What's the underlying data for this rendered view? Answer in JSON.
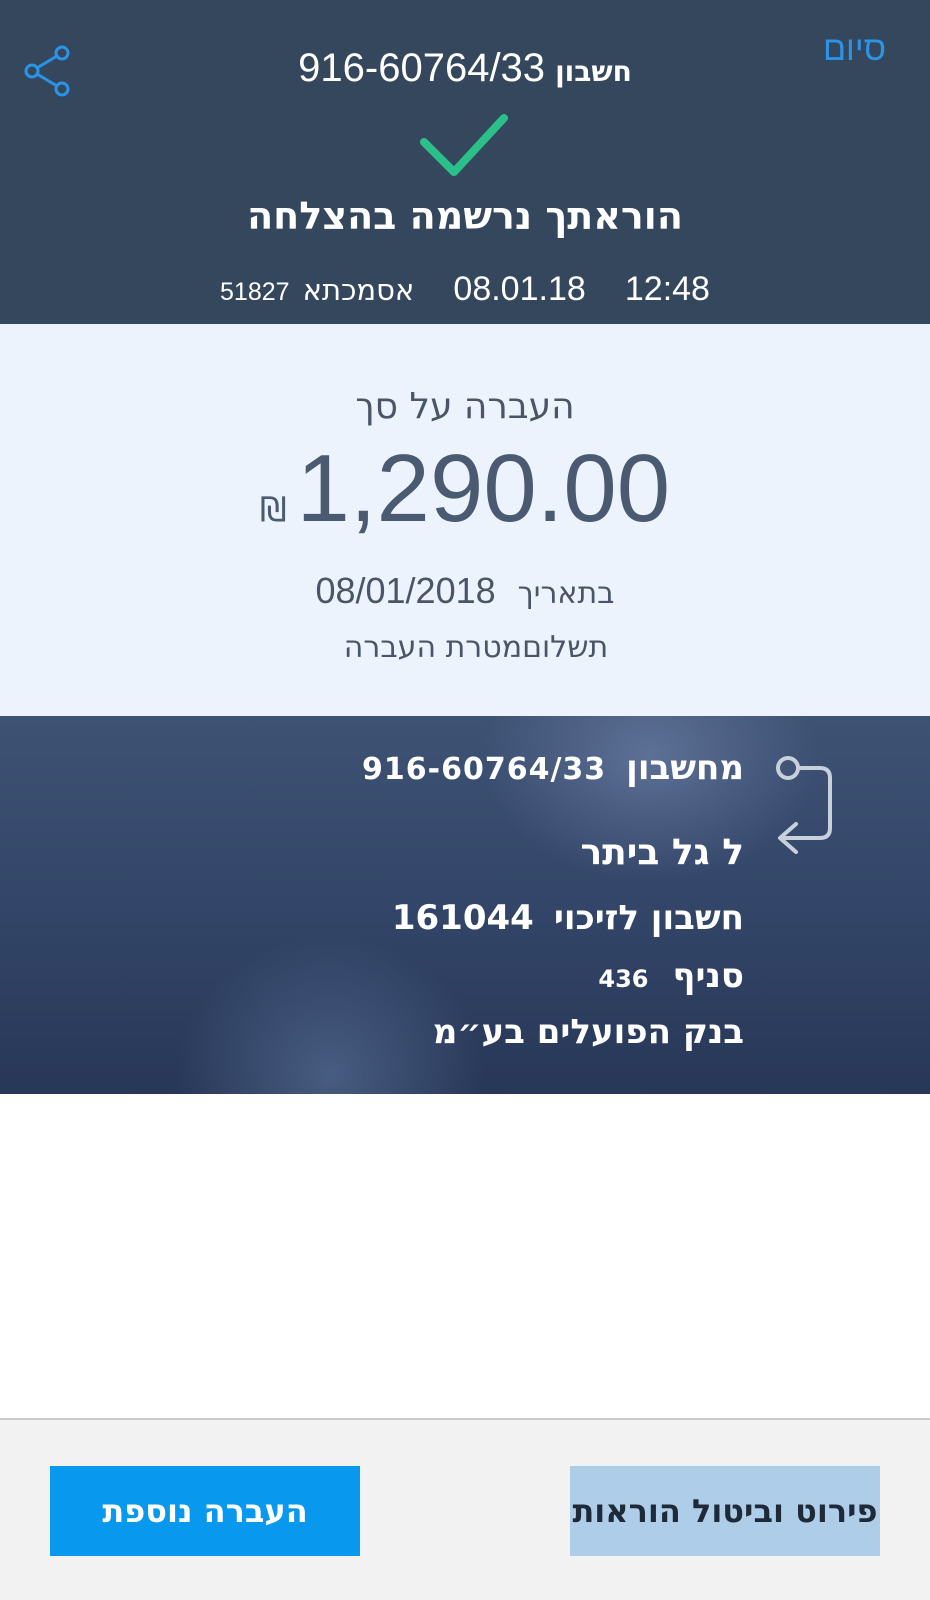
{
  "header": {
    "done_label": "סיום",
    "account_label": "חשבון",
    "account_number": "916-60764/33",
    "success_title": "הוראתך נרשמה בהצלחה",
    "time": "12:48",
    "date": "08.01.18",
    "reference_label": "אסמכתא",
    "reference_number": "51827"
  },
  "amount": {
    "label": "העברה על סך",
    "currency": "₪",
    "value": "1,290.00",
    "date_label": "בתאריך",
    "date_value": "08/01/2018",
    "purpose_label": "מטרת העברה",
    "purpose_value": "תשלום"
  },
  "transfer": {
    "from_label": "מחשבון",
    "from_account": "916-60764/33",
    "to_label": "ל גל ביתר",
    "credit_account_label": "חשבון לזיכוי",
    "credit_account": "161044",
    "branch_label": "סניף",
    "branch": "436",
    "bank": "בנק הפועלים בע״מ"
  },
  "footer": {
    "another_transfer_label": "העברה נוספת",
    "details_cancel_label": "פירוט וביטול הוראות"
  },
  "icons": {
    "share": "share-icon",
    "check": "check-icon",
    "transfer_arrow": "transfer-arrow-icon"
  },
  "colors": {
    "header_bg": "#35475d",
    "accent_blue": "#2a94e6",
    "success_green": "#2bbf8a",
    "amount_panel_bg": "#edf3fc",
    "primary_button": "#0898ee",
    "secondary_button": "#aecde9"
  }
}
